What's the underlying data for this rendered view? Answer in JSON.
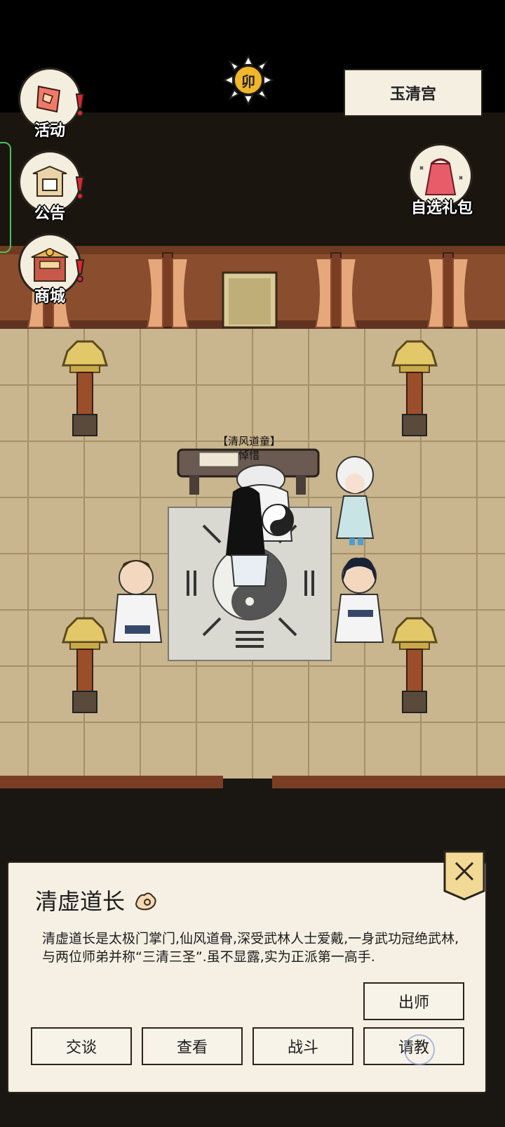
{
  "hud": {
    "time_badge": "卯",
    "location": "玉清宫"
  },
  "menu": [
    {
      "label": "活动",
      "icon": "event-scroll-icon"
    },
    {
      "label": "公告",
      "icon": "notice-board-icon"
    },
    {
      "label": "商城",
      "icon": "shop-icon"
    }
  ],
  "gift": {
    "label": "自选礼包",
    "icon": "gift-bag-icon"
  },
  "npc_tag": {
    "title": "【清风道童】",
    "name": "悼惜"
  },
  "dialog": {
    "name": "清虚道长",
    "description": "清虚道长是太极门掌门,仙风道骨,深受武林人士爱戴,一身武功冠绝武林,与两位师弟并称“三清三圣”.虽不显露,实为正派第一高手.",
    "buttons": {
      "graduate": "出师",
      "talk": "交谈",
      "view": "查看",
      "fight": "战斗",
      "learn": "请教"
    }
  },
  "colors": {
    "floor": "#c9b58e",
    "wall": "#8a4e2e",
    "panel": "#f5f0e3",
    "alert": "#e0262b"
  }
}
